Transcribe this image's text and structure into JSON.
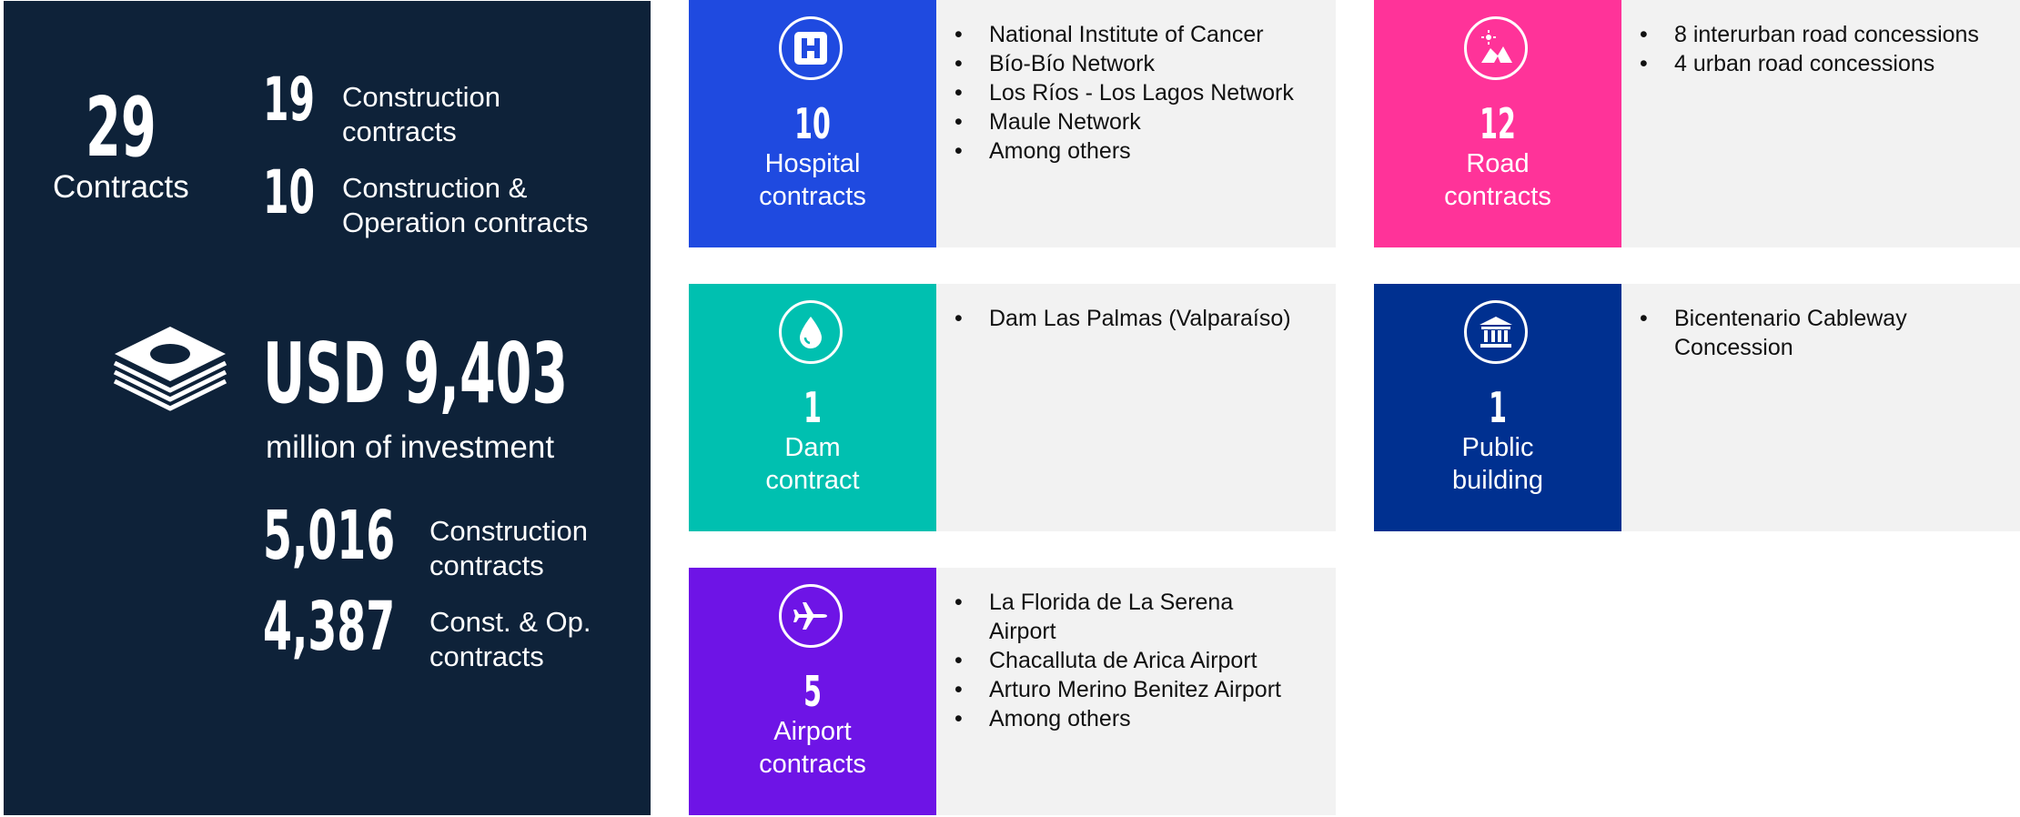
{
  "summary": {
    "contracts_total": "29",
    "contracts_label": "Contracts",
    "construction_count": "19",
    "construction_label_1": "Construction",
    "construction_label_2": "contracts",
    "cons_op_count": "10",
    "cons_op_label_1": "Construction &",
    "cons_op_label_2": "Operation contracts",
    "investment_amount": "USD 9,403",
    "investment_label": "million of investment",
    "inv_construction_value": "5,016",
    "inv_construction_label_1": "Construction",
    "inv_construction_label_2": "contracts",
    "inv_consop_value": "4,387",
    "inv_consop_label_1": "Const. & Op.",
    "inv_consop_label_2": "contracts",
    "icon": "money-stack-icon"
  },
  "categories": [
    {
      "id": "hospital",
      "count": "10",
      "label_1": "Hospital",
      "label_2": "contracts",
      "color": "#1f4ae0",
      "icon": "hospital-icon",
      "items": [
        "National Institute of Cancer",
        "Bío-Bío Network",
        "Los Ríos - Los Lagos Network",
        "Maule Network",
        "Among others"
      ]
    },
    {
      "id": "road",
      "count": "12",
      "label_1": "Road",
      "label_2": "contracts",
      "color": "#ff3399",
      "icon": "road-icon",
      "items": [
        "8 interurban road concessions",
        "4 urban road concessions"
      ]
    },
    {
      "id": "dam",
      "count": "1",
      "label_1": "Dam",
      "label_2": "contract",
      "color": "#00c0b0",
      "icon": "water-drop-icon",
      "items": [
        "Dam Las Palmas (Valparaíso)"
      ]
    },
    {
      "id": "public",
      "count": "1",
      "label_1": "Public",
      "label_2": "building",
      "color": "#003090",
      "icon": "public-building-icon",
      "items": [
        "Bicentenario Cableway",
        "Concession"
      ]
    },
    {
      "id": "airport",
      "count": "5",
      "label_1": "Airport",
      "label_2": "contracts",
      "color": "#6e14e6",
      "icon": "airplane-icon",
      "items": [
        "La Florida de La Serena",
        "Airport",
        "Chacalluta de Arica Airport",
        "Arturo Merino Benitez Airport",
        "Among others"
      ]
    }
  ]
}
